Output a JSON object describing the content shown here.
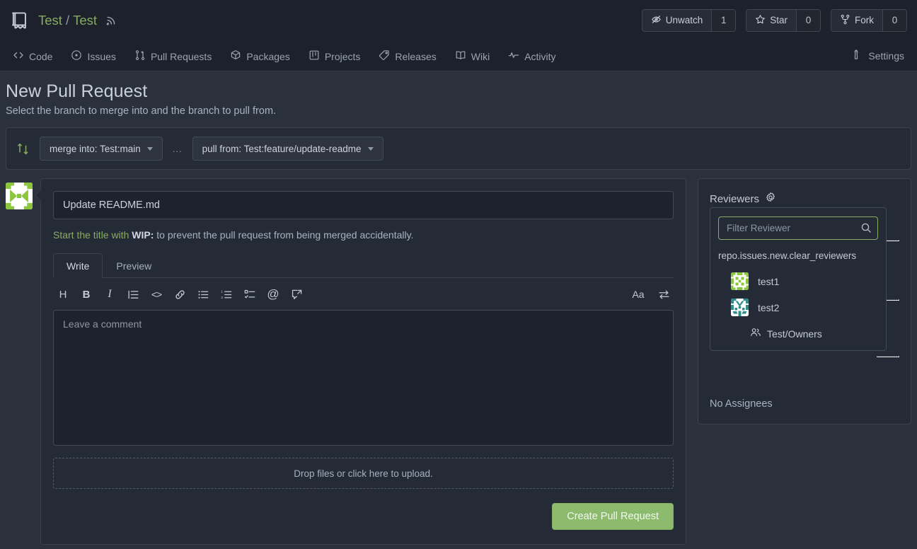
{
  "header": {
    "repo_owner": "Test",
    "repo_separator": "/",
    "repo_name": "Test",
    "repo_icon": "repo-book-icon",
    "rss_icon": "rss-icon",
    "actions": [
      {
        "label": "Unwatch",
        "count": "1",
        "icon": "eye-slash-icon"
      },
      {
        "label": "Star",
        "count": "0",
        "icon": "star-icon"
      },
      {
        "label": "Fork",
        "count": "0",
        "icon": "fork-icon"
      }
    ]
  },
  "nav": {
    "items": [
      {
        "label": "Code",
        "icon": "code-icon"
      },
      {
        "label": "Issues",
        "icon": "issue-circle-icon"
      },
      {
        "label": "Pull Requests",
        "icon": "git-pull-request-icon"
      },
      {
        "label": "Packages",
        "icon": "package-cube-icon"
      },
      {
        "label": "Projects",
        "icon": "project-board-icon"
      },
      {
        "label": "Releases",
        "icon": "tag-icon"
      },
      {
        "label": "Wiki",
        "icon": "book-icon"
      },
      {
        "label": "Activity",
        "icon": "pulse-icon"
      }
    ],
    "settings": {
      "label": "Settings",
      "icon": "wrench-icon"
    }
  },
  "page": {
    "title": "New Pull Request",
    "subtitle": "Select the branch to merge into and the branch to pull from."
  },
  "branch_bar": {
    "swap_icon": "compare-arrows-icon",
    "merge_into": "merge into: Test:main",
    "separator": "...",
    "pull_from": "pull from: Test:feature/update-readme"
  },
  "form": {
    "avatar": "user-identicon",
    "title_value": "Update README.md",
    "hint_prefix": "Start the title with ",
    "hint_wip": "WIP:",
    "hint_suffix": " to prevent the pull request from being merged accidentally.",
    "tabs": [
      {
        "label": "Write",
        "active": true
      },
      {
        "label": "Preview",
        "active": false
      }
    ],
    "toolbar": [
      {
        "icon": "heading-icon",
        "glyph": "H"
      },
      {
        "icon": "bold-icon",
        "glyph": "B"
      },
      {
        "icon": "italic-icon",
        "glyph": "I"
      },
      {
        "icon": "quote-icon",
        "glyph": ""
      },
      {
        "icon": "code-icon",
        "glyph": "<>"
      },
      {
        "icon": "link-icon",
        "glyph": ""
      },
      {
        "icon": "unordered-list-icon",
        "glyph": ""
      },
      {
        "icon": "ordered-list-icon",
        "glyph": ""
      },
      {
        "icon": "task-list-icon",
        "glyph": ""
      },
      {
        "icon": "mention-icon",
        "glyph": "@"
      },
      {
        "icon": "reference-icon",
        "glyph": ""
      }
    ],
    "toolbar_right": [
      {
        "icon": "text-size-icon",
        "glyph": "Aa"
      },
      {
        "icon": "switch-editor-icon",
        "glyph": ""
      }
    ],
    "comment_placeholder": "Leave a comment",
    "comment_value": "",
    "dropzone_label": "Drop files or click here to upload.",
    "submit_label": "Create Pull Request"
  },
  "sidebar": {
    "reviewers_label": "Reviewers",
    "reviewers_gear_icon": "gear-icon",
    "no_assignees_label": "No Assignees",
    "popup": {
      "filter_placeholder": "Filter Reviewer",
      "search_icon": "search-icon",
      "clear_label": "repo.issues.new.clear_reviewers",
      "reviewers": [
        {
          "name": "test1",
          "avatar": "identicon-green"
        },
        {
          "name": "test2",
          "avatar": "identicon-teal"
        }
      ],
      "team": {
        "label": "Test/Owners",
        "icon": "people-icon"
      }
    }
  },
  "colors": {
    "accent_green": "#87ab63",
    "button_green": "#8cbb6e",
    "page_bg": "#2a313c",
    "card_bg": "#252b36",
    "input_bg": "#1d222c",
    "header_bg": "#1c212b",
    "border": "#3a404d"
  }
}
